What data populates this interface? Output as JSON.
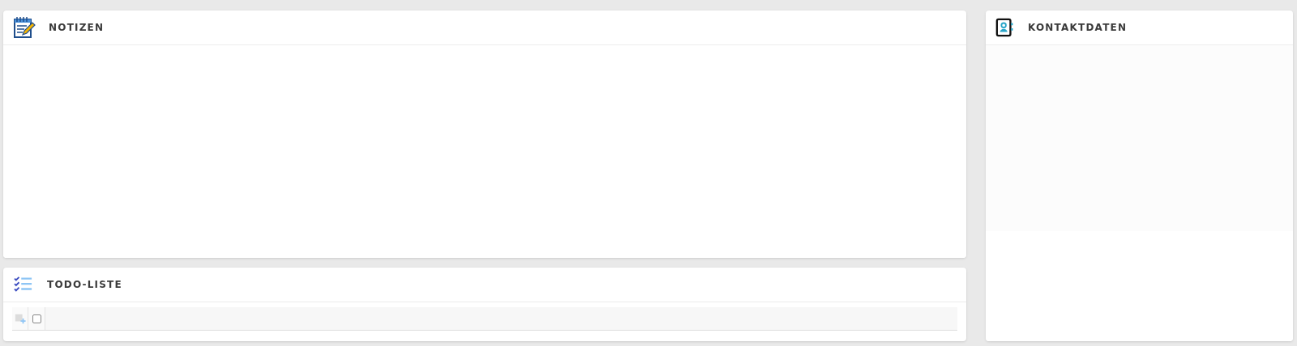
{
  "notes_panel": {
    "title": "NOTIZEN"
  },
  "todo_panel": {
    "title": "TODO-LISTE",
    "items": [
      {
        "checked": false
      }
    ]
  },
  "contact_panel": {
    "title": "KONTAKTDATEN"
  }
}
